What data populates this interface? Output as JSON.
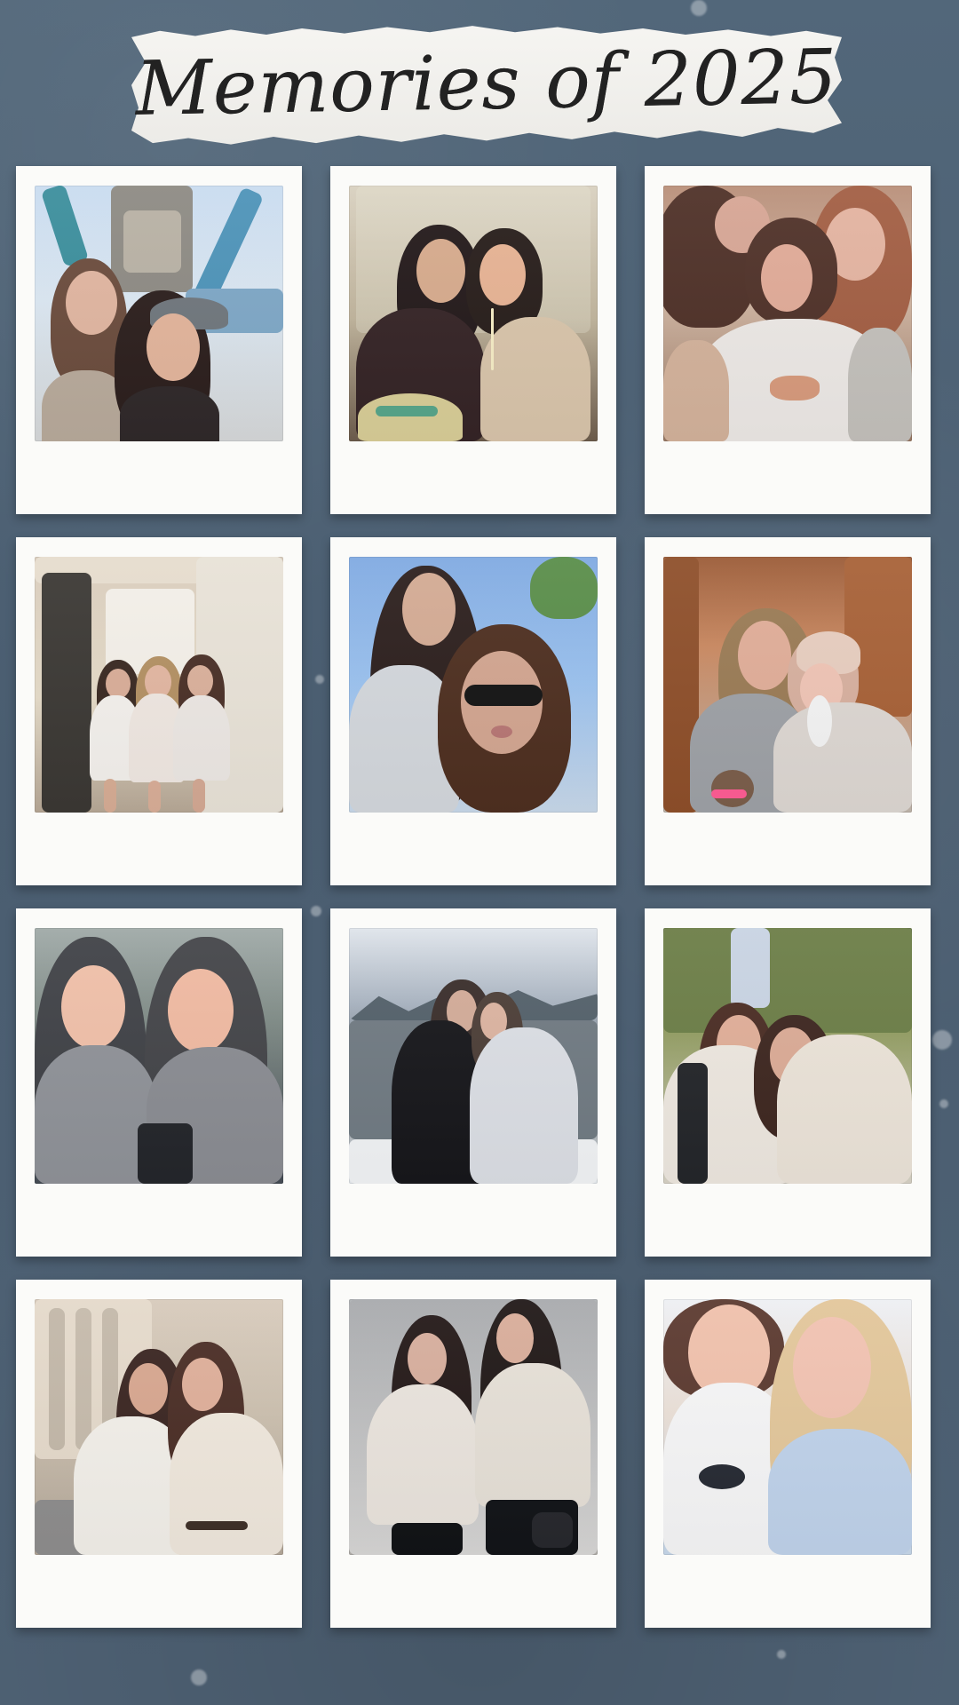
{
  "title": "Memories of 2025",
  "colors": {
    "background": "#4d6072",
    "title_paper": "#f6f5f2",
    "polaroid_frame": "#fbfbf9",
    "title_ink": "#222222"
  },
  "photos": [
    {
      "name": "polaroid-photo-01"
    },
    {
      "name": "polaroid-photo-02"
    },
    {
      "name": "polaroid-photo-03"
    },
    {
      "name": "polaroid-photo-04"
    },
    {
      "name": "polaroid-photo-05"
    },
    {
      "name": "polaroid-photo-06"
    },
    {
      "name": "polaroid-photo-07"
    },
    {
      "name": "polaroid-photo-08"
    },
    {
      "name": "polaroid-photo-09"
    },
    {
      "name": "polaroid-photo-10"
    },
    {
      "name": "polaroid-photo-11"
    },
    {
      "name": "polaroid-photo-12"
    }
  ]
}
